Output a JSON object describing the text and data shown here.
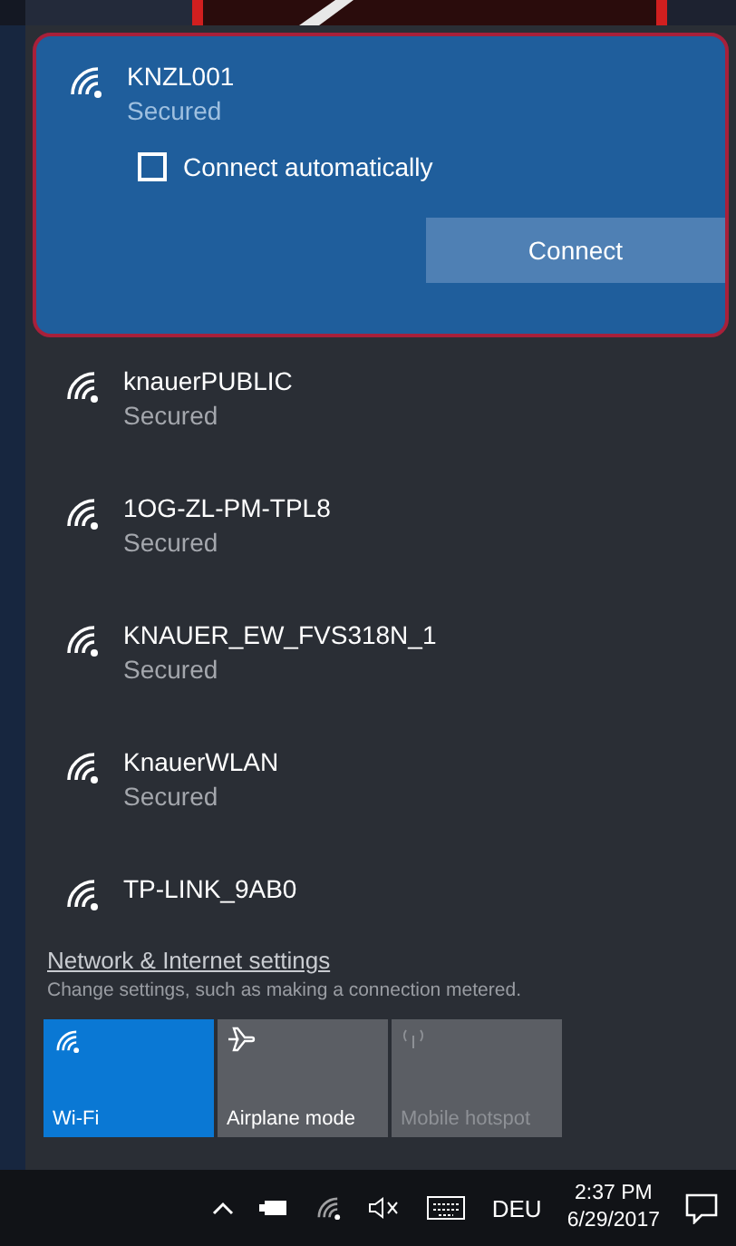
{
  "networks": [
    {
      "name": "KNZL001",
      "status": "Secured",
      "selected": true,
      "connect_automatically": {
        "label": "Connect automatically",
        "checked": false
      },
      "button": "Connect"
    },
    {
      "name": "knauerPUBLIC",
      "status": "Secured",
      "selected": false
    },
    {
      "name": "1OG-ZL-PM-TPL8",
      "status": "Secured",
      "selected": false
    },
    {
      "name": "KNAUER_EW_FVS318N_1",
      "status": "Secured",
      "selected": false
    },
    {
      "name": "KnauerWLAN",
      "status": "Secured",
      "selected": false
    },
    {
      "name": "TP-LINK_9AB0",
      "selected": false
    }
  ],
  "settings": {
    "link": "Network & Internet settings",
    "description": "Change settings, such as making a connection metered."
  },
  "quick_actions": [
    {
      "kind": "wifi",
      "label": "Wi-Fi",
      "on": true,
      "disabled": false
    },
    {
      "kind": "airplane",
      "label": "Airplane mode",
      "on": false,
      "disabled": false
    },
    {
      "kind": "hotspot",
      "label": "Mobile hotspot",
      "on": false,
      "disabled": true
    }
  ],
  "taskbar": {
    "language": "DEU",
    "time": "2:37 PM",
    "date": "6/29/2017"
  }
}
